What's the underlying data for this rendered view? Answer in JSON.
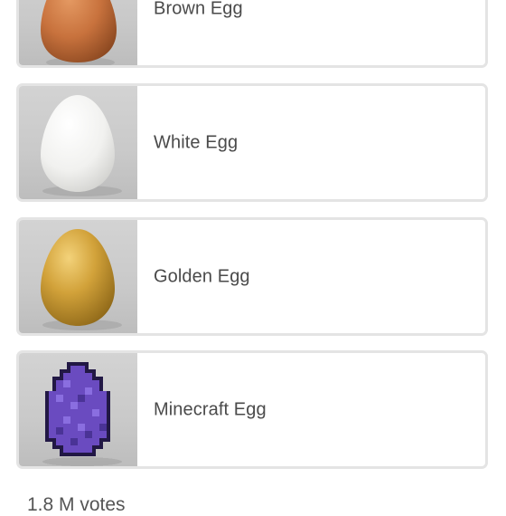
{
  "poll": {
    "options": [
      {
        "label": "Brown Egg",
        "image": "brown-egg-photo",
        "color": "#c9763f"
      },
      {
        "label": "White Egg",
        "image": "white-egg-photo",
        "color": "#f4f4f2"
      },
      {
        "label": "Golden Egg",
        "image": "golden-egg-photo",
        "color": "#c7972a"
      },
      {
        "label": "Minecraft Egg",
        "image": "minecraft-spawn-egg-pixel",
        "color": "#6a4bc0"
      }
    ],
    "votes_text": "1.8 M votes"
  }
}
